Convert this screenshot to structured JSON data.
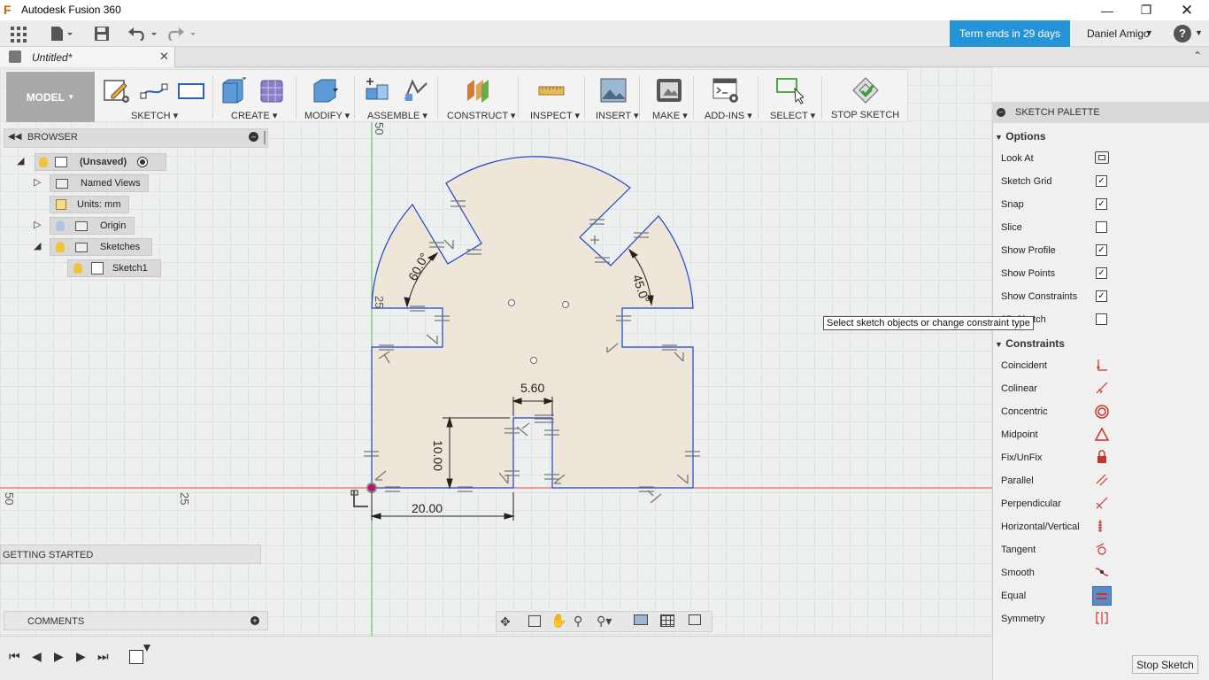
{
  "window": {
    "title": "Autodesk Fusion 360"
  },
  "quickbar": {
    "term": "Term ends in 29 days",
    "user": "Daniel Amigo"
  },
  "tab": {
    "label": "Untitled*"
  },
  "toolbar": {
    "model": "MODEL",
    "groups": [
      {
        "label": "SKETCH"
      },
      {
        "label": "CREATE"
      },
      {
        "label": "MODIFY"
      },
      {
        "label": "ASSEMBLE"
      },
      {
        "label": "CONSTRUCT"
      },
      {
        "label": "INSPECT"
      },
      {
        "label": "INSERT"
      },
      {
        "label": "MAKE"
      },
      {
        "label": "ADD-INS"
      },
      {
        "label": "SELECT"
      },
      {
        "label": "STOP SKETCH"
      }
    ]
  },
  "browser": {
    "title": "BROWSER",
    "root": "(Unsaved)",
    "named_views": "Named Views",
    "units": "Units: mm",
    "origin": "Origin",
    "sketches": "Sketches",
    "sketch1": "Sketch1"
  },
  "panels": {
    "getting_started": "GETTING STARTED",
    "comments": "COMMENTS"
  },
  "canvas": {
    "dims": {
      "d1": "5.60",
      "d2": "10.00",
      "d3": "20.00",
      "a1": "60.0°",
      "a2": "45.0°"
    },
    "ruler": {
      "r50": "50",
      "r25": "25",
      "top50": "50",
      "left25": "25"
    },
    "tooltip": "Select sketch objects or change constraint type"
  },
  "palette": {
    "title": "SKETCH PALETTE",
    "options_title": "Options",
    "options": [
      {
        "label": "Look At",
        "icon": "look-at-icon"
      },
      {
        "label": "Sketch Grid",
        "checked": "✓"
      },
      {
        "label": "Snap",
        "checked": "✓"
      },
      {
        "label": "Slice",
        "checked": ""
      },
      {
        "label": "Show Profile",
        "checked": "✓"
      },
      {
        "label": "Show Points",
        "checked": "✓"
      },
      {
        "label": "Show Constraints",
        "checked": "✓"
      },
      {
        "label": "3D Sketch",
        "checked": ""
      }
    ],
    "constraints_title": "Constraints",
    "constraints": [
      {
        "label": "Coincident"
      },
      {
        "label": "Colinear"
      },
      {
        "label": "Concentric"
      },
      {
        "label": "Midpoint"
      },
      {
        "label": "Fix/UnFix"
      },
      {
        "label": "Parallel"
      },
      {
        "label": "Perpendicular"
      },
      {
        "label": "Horizontal/Vertical"
      },
      {
        "label": "Tangent"
      },
      {
        "label": "Smooth"
      },
      {
        "label": "Equal"
      },
      {
        "label": "Symmetry"
      }
    ],
    "stop_sketch": "Stop Sketch"
  },
  "colors": {
    "accent": "#2594d6",
    "profile_fill": "#efe4d6",
    "sketch_line": "#1d43c9",
    "axis_red": "#e8453c",
    "constraint_red": "#c9352b"
  }
}
